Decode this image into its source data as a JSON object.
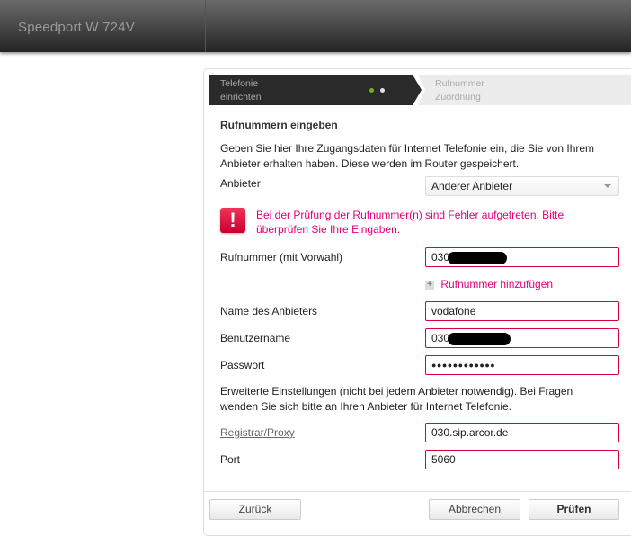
{
  "header": {
    "brand": "Speedport W 724V"
  },
  "steps": [
    {
      "label_line1": "Telefonie",
      "label_line2": "einrichten",
      "active": true
    },
    {
      "label_line1": "Rufnummer",
      "label_line2": "Zuordnung",
      "active": false
    }
  ],
  "progress_dots": {
    "total": 2,
    "current": 1,
    "colors": {
      "done": "#6fb320",
      "pending": "#e0e0e0"
    }
  },
  "form": {
    "title": "Rufnummern eingeben",
    "intro_line1": "Geben Sie hier Ihre Zugangsdaten für Internet Telefonie ein, die Sie von Ihrem",
    "intro_line2": "Anbieter erhalten haben. Diese werden im Router gespeichert.",
    "provider_label": "Anbieter",
    "provider_value": "Anderer Anbieter",
    "error_line1": "Bei der Prüfung der Rufnummer(n) sind Fehler aufgetreten. Bitte",
    "error_line2": "überprüfen Sie Ihre Eingaben.",
    "number_label": "Rufnummer (mit Vorwahl)",
    "number_value": "030",
    "add_number": "Rufnummer hinzufügen",
    "name_label": "Name des Anbieters",
    "name_value": "vodafone",
    "user_label": "Benutzername",
    "user_value": "030",
    "pass_label": "Passwort",
    "pass_value": "●●●●●●●●●●●●",
    "adv_line1": "Erweiterte Einstellungen (nicht bei jedem Anbieter notwendig). Bei Fragen",
    "adv_line2": "wenden Sie sich bitte an Ihren Anbieter für Internet Telefonie.",
    "registrar_label": "Registrar/Proxy",
    "registrar_value": "030.sip.arcor.de",
    "port_label": "Port",
    "port_value": "5060"
  },
  "buttons": {
    "back": "Zurück",
    "cancel": "Abbrechen",
    "check": "Prüfen"
  },
  "colors": {
    "error": "#e2007a",
    "invalid_border": "#d6003c"
  }
}
